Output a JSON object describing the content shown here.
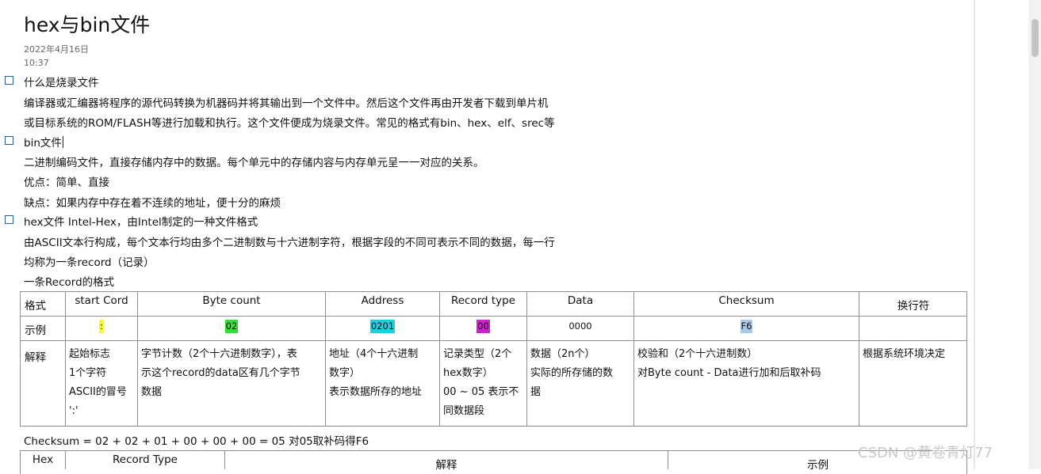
{
  "doc": {
    "title": "hex与bin文件",
    "date": "2022年4月16日",
    "time": "10:37",
    "sections": [
      {
        "heading": "什么是烧录文件",
        "lines": [
          "编译器或汇编器将程序的源代码转换为机器码并将其输出到一个文件中。然后这个文件再由开发者下载到单片机",
          "或目标系统的ROM/FLASH等进行加载和执行。这个文件便成为烧录文件。常见的格式有bin、hex、elf、srec等"
        ]
      },
      {
        "heading": "bin文件",
        "lines": [
          "二进制编码文件，直接存储内存中的数据。每个单元中的存储内容与内存单元呈一一对应的关系。",
          "优点：简单、直接",
          "缺点：如果内存中存在着不连续的地址，便十分的麻烦"
        ]
      },
      {
        "heading": "hex文件 Intel-Hex，由Intel制定的一种文件格式",
        "lines": [
          "由ASCII文本行构成，每个文本行均由多个二进制数与十六进制字符，根据字段的不同可表示不同的数据，每一行",
          "均称为一条record（记录）",
          "一条Record的格式"
        ]
      }
    ]
  },
  "record_table": {
    "headers": [
      "格式",
      "start Cord",
      "Byte count",
      "Address",
      "Record type",
      "Data",
      "Checksum",
      "换行符"
    ],
    "example": {
      "label": "示例",
      "values": [
        {
          "text": ":",
          "color": "#f5f53a"
        },
        {
          "text": "02",
          "color": "#33dd33"
        },
        {
          "text": "0201",
          "color": "#22ccdd"
        },
        {
          "text": "00",
          "color": "#cc22cc"
        },
        {
          "text": "0000",
          "color": ""
        },
        {
          "text": "F6",
          "color": "#a8c8e8"
        },
        {
          "text": "",
          "color": ""
        }
      ]
    },
    "explain": {
      "label": "解释",
      "cells": [
        [
          "起始标志",
          "1个字符",
          "ASCII的冒号",
          "':'"
        ],
        [
          "字节计数（2个十六进制数字），表",
          "示这个record的data区有几个字节",
          "数据"
        ],
        [
          "地址（4个十六进制",
          "数字）",
          "表示数据所存的地址"
        ],
        [
          "记录类型（2个",
          "hex数字）",
          "00 ~ 05 表示不",
          "同数据段"
        ],
        [
          "数据（2n个）",
          "实际的所存储的数",
          "据"
        ],
        [
          "校验和（2个十六进制数）",
          "对Byte count - Data进行加和后取补码"
        ],
        [
          "根据系统环境决定"
        ]
      ]
    }
  },
  "checksum_line": "Checksum = 02 + 02 + 01 + 00 + 00 + 00 = 05 对05取补码得F6",
  "record_type_table": {
    "headers": [
      "Hex",
      "Record Type",
      "解释",
      "示例"
    ]
  },
  "watermark": "CSDN @黄卷青灯77"
}
